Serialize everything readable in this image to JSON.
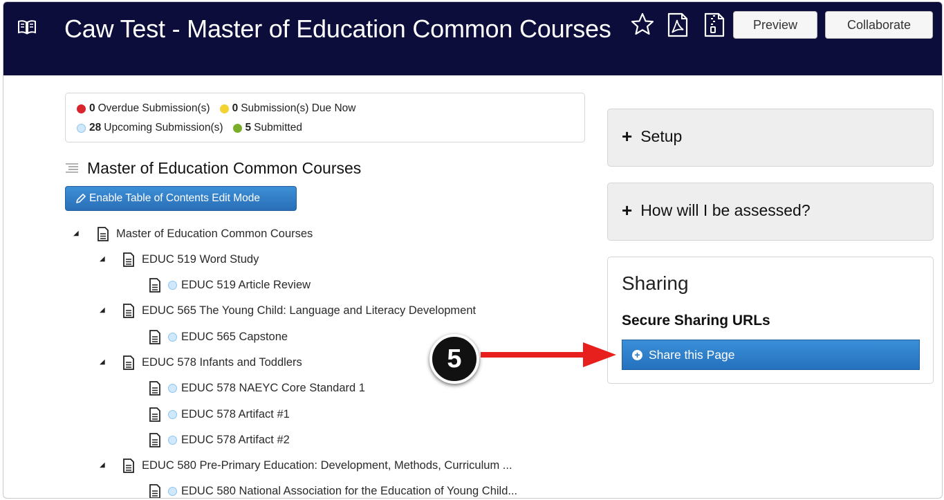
{
  "header": {
    "title": "Caw Test - Master of Education Common Courses",
    "preview_label": "Preview",
    "collaborate_label": "Collaborate",
    "icons": [
      "book-icon",
      "star-icon",
      "pdf-icon",
      "zip-icon"
    ],
    "background": "#0c0d3a"
  },
  "status": {
    "overdue_count": "0",
    "overdue_label": "Overdue Submission(s)",
    "due_now_count": "0",
    "due_now_label": "Submission(s) Due Now",
    "upcoming_count": "28",
    "upcoming_label": "Upcoming Submission(s)",
    "submitted_count": "5",
    "submitted_label": "Submitted",
    "colors": {
      "overdue": "#d9252e",
      "due_now": "#f3d233",
      "upcoming": "#cfe8fb",
      "submitted": "#7aad2b"
    }
  },
  "toc": {
    "title": "Master of Education Common Courses",
    "edit_button_label": "Enable Table of Contents Edit Mode",
    "items": [
      {
        "label": "Master of Education Common Courses"
      },
      {
        "label": "EDUC 519 Word Study"
      },
      {
        "label": "EDUC 519 Article Review"
      },
      {
        "label": "EDUC 565 The Young Child: Language and Literacy Development"
      },
      {
        "label": "EDUC 565 Capstone"
      },
      {
        "label": "EDUC 578 Infants and Toddlers"
      },
      {
        "label": "EDUC 578 NAEYC Core Standard 1"
      },
      {
        "label": "EDUC 578 Artifact #1"
      },
      {
        "label": "EDUC 578 Artifact #2"
      },
      {
        "label": "EDUC 580 Pre-Primary Education: Development, Methods, Curriculum ..."
      },
      {
        "label": "EDUC 580 National Association for the Education of Young Child..."
      }
    ]
  },
  "sidebar": {
    "setup_label": "Setup",
    "assessed_label": "How will I be assessed?",
    "sharing_title": "Sharing",
    "secure_urls_label": "Secure Sharing URLs",
    "share_button_label": "Share this Page"
  },
  "annotation": {
    "step_number": "5",
    "arrow_color": "#e8201d"
  }
}
